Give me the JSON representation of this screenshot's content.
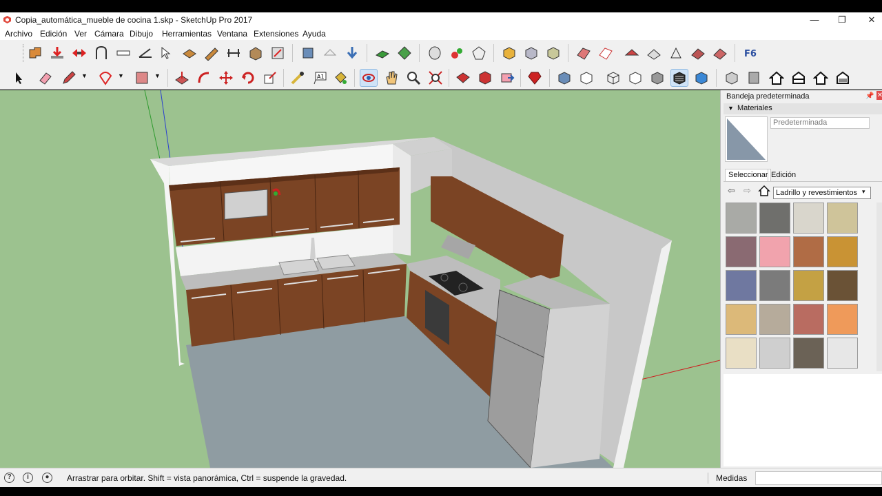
{
  "window": {
    "title": "Copia_automática_mueble de cocina 1.skp - SketchUp Pro 2017",
    "minimize_glyph": "—",
    "restore_glyph": "❐",
    "close_glyph": "✕"
  },
  "menu": [
    "Archivo",
    "Edición",
    "Ver",
    "Cámara",
    "Dibujo",
    "Herramientas",
    "Ventana",
    "Extensiones",
    "Ayuda"
  ],
  "tray": {
    "title": "Bandeja predeterminada",
    "pin_glyph": "📌",
    "close_glyph": "✕",
    "materials": {
      "header": "Materiales",
      "expand_glyph": "▼",
      "material_name": "Predeterminada",
      "tabs": [
        "Seleccionar",
        "Edición"
      ],
      "back_glyph": "⇦",
      "forward_glyph": "⇨",
      "library": "Ladrillo y revestimientos",
      "chevron_glyph": "▾",
      "swatches": [
        {
          "name": "swatch-1",
          "color": "#a9aaa6"
        },
        {
          "name": "swatch-2",
          "color": "#6f6f6c"
        },
        {
          "name": "swatch-3",
          "color": "#d9d6cc"
        },
        {
          "name": "swatch-4",
          "color": "#cfc49a"
        },
        {
          "name": "swatch-5",
          "color": "#8a6a72"
        },
        {
          "name": "swatch-6",
          "color": "#f1a3ad"
        },
        {
          "name": "swatch-7",
          "color": "#b06c45"
        },
        {
          "name": "swatch-8",
          "color": "#c99334"
        },
        {
          "name": "swatch-9",
          "color": "#6f78a0"
        },
        {
          "name": "swatch-10",
          "color": "#7b7b7b"
        },
        {
          "name": "swatch-11",
          "color": "#c4a144"
        },
        {
          "name": "swatch-12",
          "color": "#6a5236"
        },
        {
          "name": "swatch-13",
          "color": "#dcb979"
        },
        {
          "name": "swatch-14",
          "color": "#b6ab9b"
        },
        {
          "name": "swatch-15",
          "color": "#b96c61"
        },
        {
          "name": "swatch-16",
          "color": "#ef9a5a"
        },
        {
          "name": "swatch-17",
          "color": "#e9dfc5"
        },
        {
          "name": "swatch-18",
          "color": "#cfcfcf"
        },
        {
          "name": "swatch-19",
          "color": "#6b6256"
        },
        {
          "name": "swatch-20",
          "color": "#e7e7e7"
        }
      ]
    }
  },
  "status": {
    "hint": "Arrastrar para orbitar. Shift = vista panorámica, Ctrl = suspende la gravedad.",
    "info_glyph": "i",
    "measurements_label": "Medidas"
  },
  "colors": {
    "viewport_background": "#9cc28f",
    "cabinet_wood": "#7b4424",
    "countertop": "#bdbdbd",
    "floor": "#8f9da3",
    "wall": "#e9e9e9",
    "active_tool": "#cfe3f7"
  }
}
